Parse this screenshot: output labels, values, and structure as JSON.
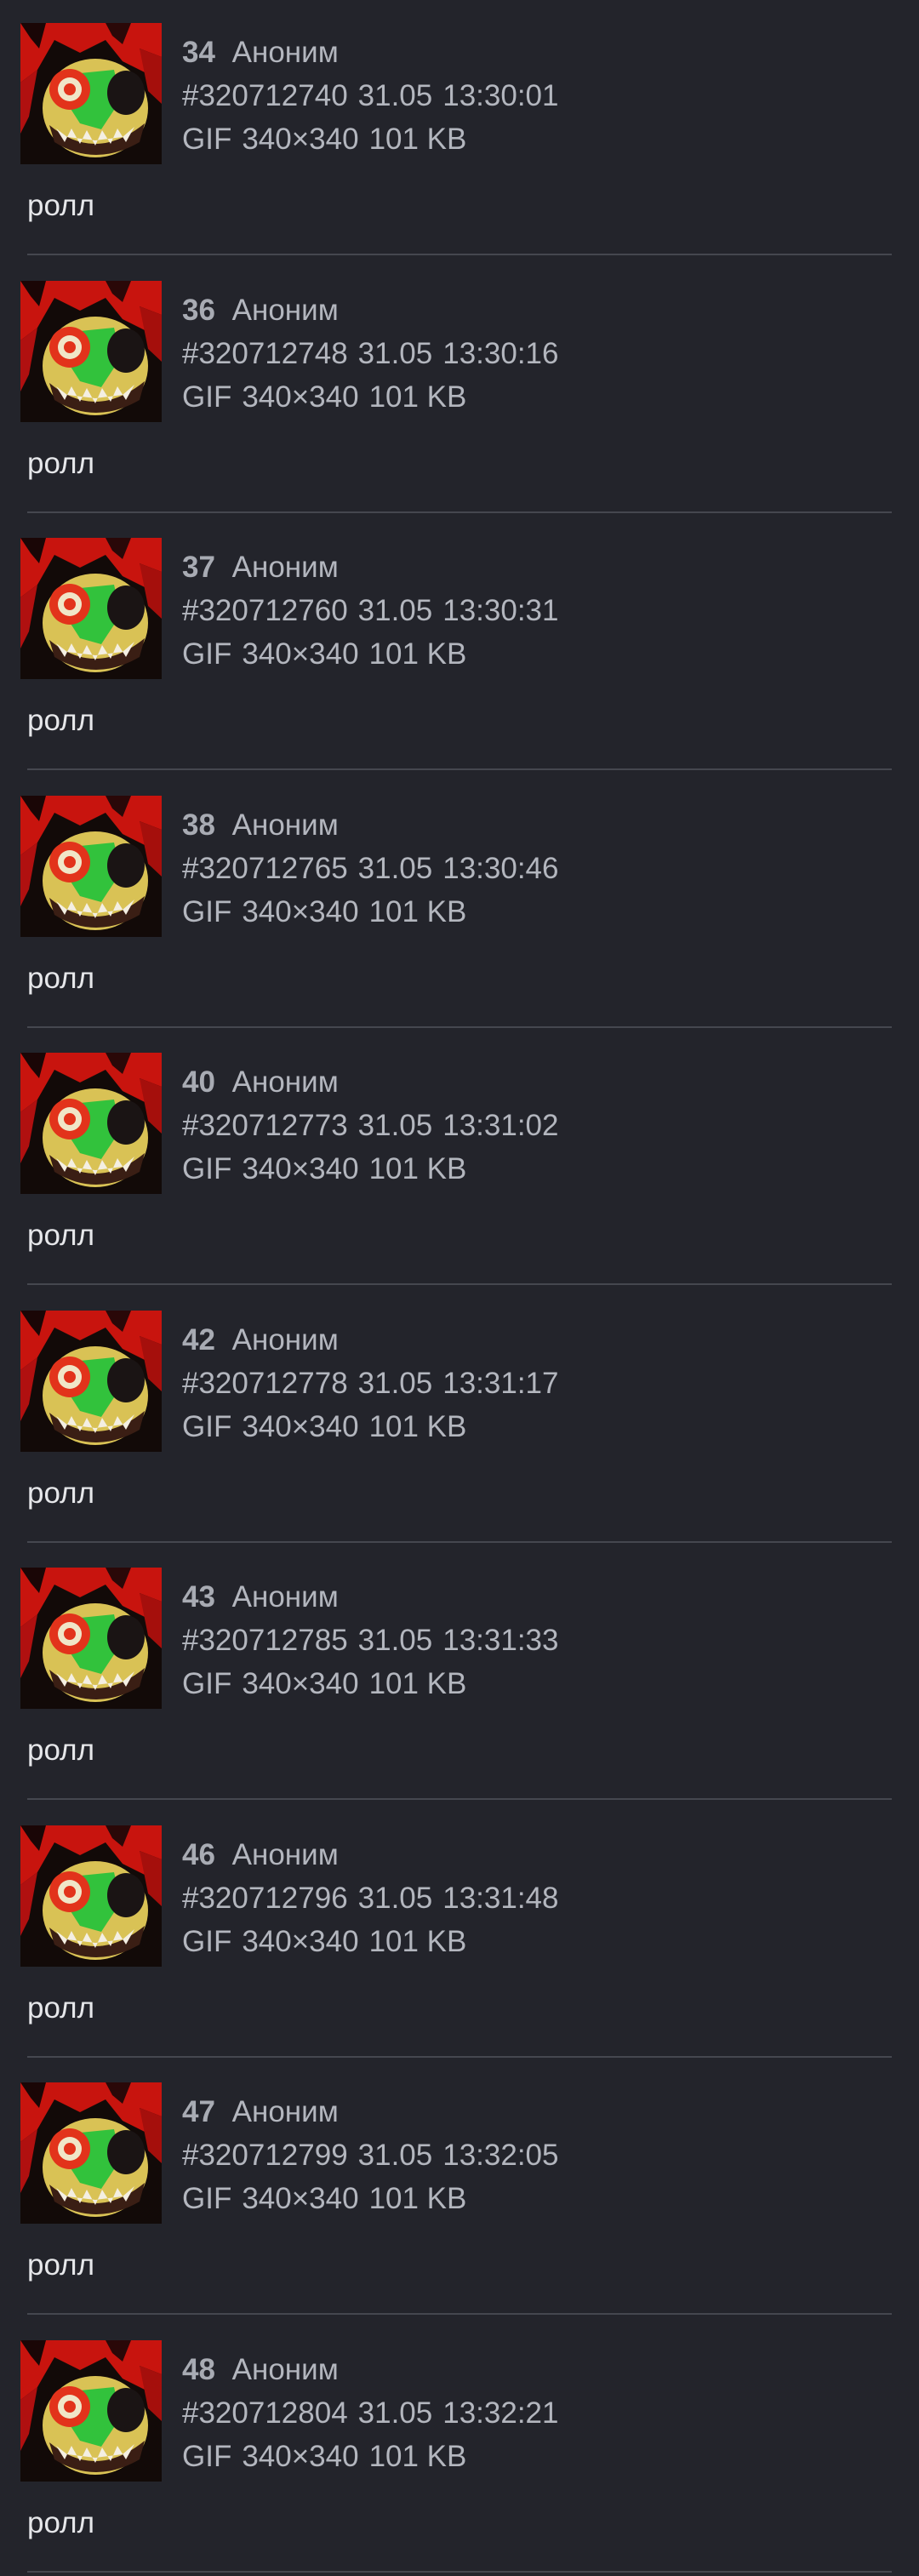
{
  "theme": {
    "background": "#23242b",
    "divider": "#45474f",
    "text": "#b3b6be",
    "comment": "#e6e7ea"
  },
  "thumbnail_icon": "gif-thumbnail",
  "posts": [
    {
      "num": "34",
      "author": "Аноним",
      "id": "#320712740",
      "date": "31.05",
      "time": "13:30:01",
      "file_type": "GIF",
      "file_dims": "340×340",
      "file_size": "101 KB",
      "comment": "ролл"
    },
    {
      "num": "36",
      "author": "Аноним",
      "id": "#320712748",
      "date": "31.05",
      "time": "13:30:16",
      "file_type": "GIF",
      "file_dims": "340×340",
      "file_size": "101 KB",
      "comment": "ролл"
    },
    {
      "num": "37",
      "author": "Аноним",
      "id": "#320712760",
      "date": "31.05",
      "time": "13:30:31",
      "file_type": "GIF",
      "file_dims": "340×340",
      "file_size": "101 KB",
      "comment": "ролл"
    },
    {
      "num": "38",
      "author": "Аноним",
      "id": "#320712765",
      "date": "31.05",
      "time": "13:30:46",
      "file_type": "GIF",
      "file_dims": "340×340",
      "file_size": "101 KB",
      "comment": "ролл"
    },
    {
      "num": "40",
      "author": "Аноним",
      "id": "#320712773",
      "date": "31.05",
      "time": "13:31:02",
      "file_type": "GIF",
      "file_dims": "340×340",
      "file_size": "101 KB",
      "comment": "ролл"
    },
    {
      "num": "42",
      "author": "Аноним",
      "id": "#320712778",
      "date": "31.05",
      "time": "13:31:17",
      "file_type": "GIF",
      "file_dims": "340×340",
      "file_size": "101 KB",
      "comment": "ролл"
    },
    {
      "num": "43",
      "author": "Аноним",
      "id": "#320712785",
      "date": "31.05",
      "time": "13:31:33",
      "file_type": "GIF",
      "file_dims": "340×340",
      "file_size": "101 KB",
      "comment": "ролл"
    },
    {
      "num": "46",
      "author": "Аноним",
      "id": "#320712796",
      "date": "31.05",
      "time": "13:31:48",
      "file_type": "GIF",
      "file_dims": "340×340",
      "file_size": "101 KB",
      "comment": "ролл"
    },
    {
      "num": "47",
      "author": "Аноним",
      "id": "#320712799",
      "date": "31.05",
      "time": "13:32:05",
      "file_type": "GIF",
      "file_dims": "340×340",
      "file_size": "101 KB",
      "comment": "ролл"
    },
    {
      "num": "48",
      "author": "Аноним",
      "id": "#320712804",
      "date": "31.05",
      "time": "13:32:21",
      "file_type": "GIF",
      "file_dims": "340×340",
      "file_size": "101 KB",
      "comment": "ролл"
    }
  ]
}
